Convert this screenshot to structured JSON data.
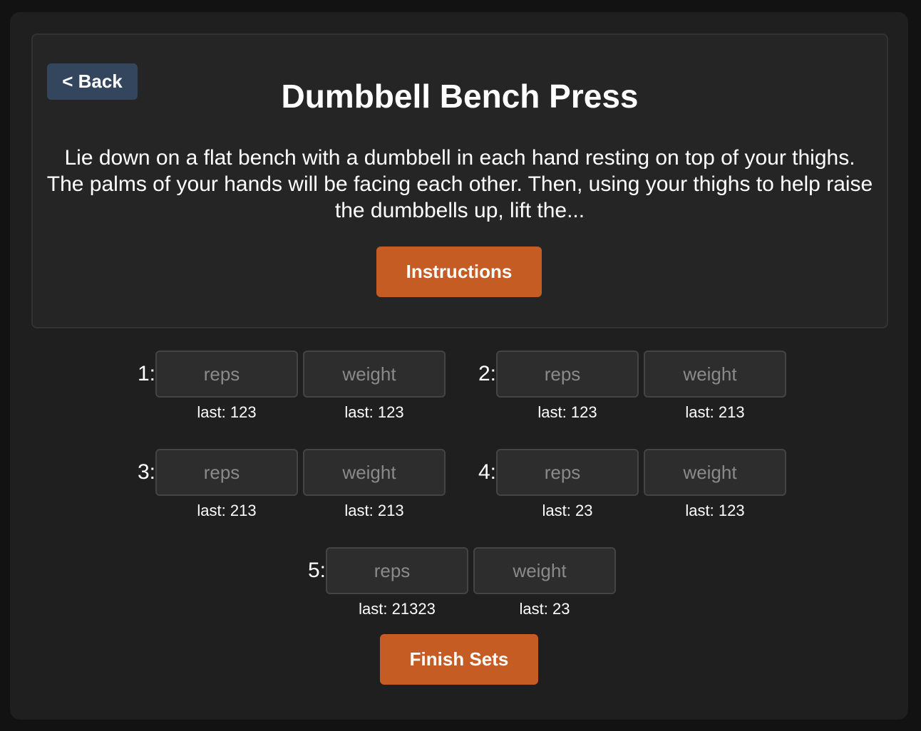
{
  "header": {
    "back_label": "< Back",
    "title": "Dumbbell Bench Press",
    "description": "Lie down on a flat bench with a dumbbell in each hand resting on top of your thighs. The palms of your hands will be facing each other. Then, using your thighs to help raise the dumbbells up, lift the...",
    "instructions_label": "Instructions"
  },
  "sets": [
    {
      "label": "1:",
      "reps_placeholder": "reps",
      "weight_placeholder": "weight",
      "last_reps": "last: 123",
      "last_weight": "last: 123"
    },
    {
      "label": "2:",
      "reps_placeholder": "reps",
      "weight_placeholder": "weight",
      "last_reps": "last: 123",
      "last_weight": "last: 213"
    },
    {
      "label": "3:",
      "reps_placeholder": "reps",
      "weight_placeholder": "weight",
      "last_reps": "last: 213",
      "last_weight": "last: 213"
    },
    {
      "label": "4:",
      "reps_placeholder": "reps",
      "weight_placeholder": "weight",
      "last_reps": "last: 23",
      "last_weight": "last: 123"
    },
    {
      "label": "5:",
      "reps_placeholder": "reps",
      "weight_placeholder": "weight",
      "last_reps": "last: 21323",
      "last_weight": "last: 23"
    }
  ],
  "footer": {
    "finish_label": "Finish Sets"
  },
  "colors": {
    "accent": "#c55c24",
    "back_button": "#34465e",
    "background": "#1f1f1f",
    "card": "#252525"
  }
}
